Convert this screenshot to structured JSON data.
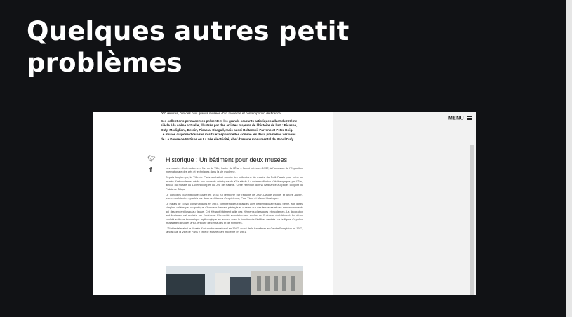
{
  "slide": {
    "title": "Quelques autres petit problèmes"
  },
  "screenshot": {
    "menu_label": "MENU",
    "intro": [
      "000 œuvres, l'un des plus grands musées d'art moderne et contemporain de France.",
      "Ses collections permanentes présentent les grands courants artistiques allant du XXème siècle à la scène actuelle, illustrés par des artistes majeurs de l'histoire de l'art : Picasso, Dufy, Modigliani, Derain, Picabia, Chagall, mais aussi Boltanski, Parreno et Peter Doig. Le musée dispose d'œuvres in situ exceptionnelles comme les deux premières versions de La Danse de Matisse ou La Fée électricité, chef d'œuvre monumental de Raoul Dufy."
    ],
    "heading": "Historique : Un bâtiment pour deux musées",
    "paragraphs": [
      "Les musées d'art moderne – l'un de la Ville, l'autre de l'État – furent créés en 1937, à l'occasion de l'Exposition internationale des arts et techniques dans la vie moderne.",
      "Depuis longtemps, la Ville de Paris souhaitait scinder les collections du musée du Petit Palais pour créer un musée d'art moderne, dédié aux courants artistiques du XXe siècle. La même réflexion s'était engagée, par l'État, autour du musée du Luxembourg et du Jeu de Paume. Cette réflexion donna naissance au projet conjoint du Palais de Tokyo.",
      "Le concours d'architecture ouvert en 1934 fut remporté par l'équipe de Jean-Claude Dondel et André Aubert, jeunes architectes épaulés par deux architectes d'expérience, Paul Viard et Marcel Dastugue.",
      "Le Palais de Tokyo, construit dans en 1937, comprend deux grandes ailes perpendiculaires à la Seine, aux lignes simples, reliées par un portique d'honneur formant péristyle et ouvrant sur des terrasses et des emmarchements qui descendent jusqu'au fleuve. Cet élégant bâtiment allie des éléments classiques et modernes. La décoration architecturale est centrée sur l'extérieur. Elle a été volontairement exclue de l'intérieur du bâtiment. Le décor sculpté suit une thématique mythologique en accord avec la fonction de l'édifice, centrée sur la figure d'Apollon musagète (dieu des arts), entouré de centaures et de nymphes.",
      "L'État installe ainsi le Musée d'art moderne national en 1947, avant de le transférer au Centre Pompidou en 1977, tandis que la Ville de Paris y crée le Musée d'art moderne en 1961."
    ]
  },
  "icons": {
    "share_twitter": "twitter-icon",
    "share_facebook": "facebook-icon",
    "menu": "hamburger-icon"
  },
  "colors": {
    "slide_background": "#111215",
    "title_text": "#ffffff",
    "page_background": "#ffffff",
    "side_panel": "#f2f2f2"
  }
}
